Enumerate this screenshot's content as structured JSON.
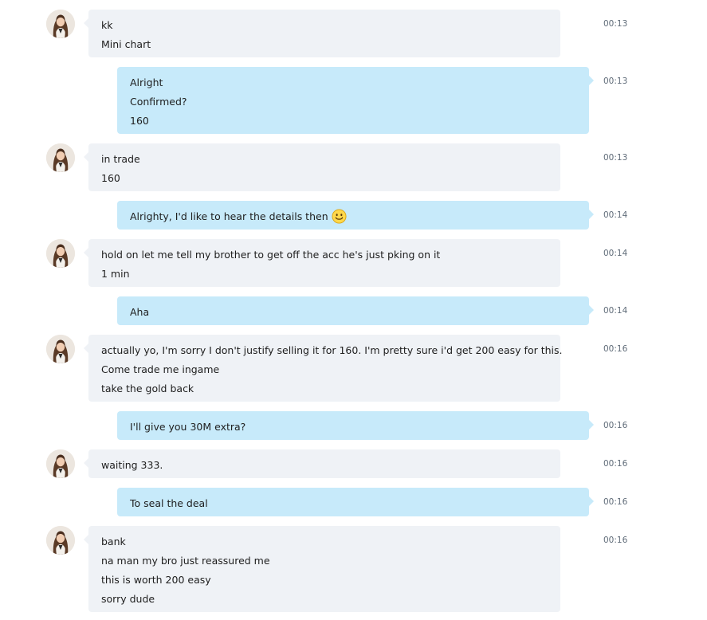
{
  "colors": {
    "incoming_bubble": "#eff2f6",
    "outgoing_bubble": "#c7eafa",
    "timestamp": "#5f6b78"
  },
  "messages": [
    {
      "direction": "incoming",
      "time": "00:13",
      "lines": [
        "kk",
        "Mini chart"
      ]
    },
    {
      "direction": "outgoing",
      "time": "00:13",
      "lines": [
        "Alright",
        "Confirmed?",
        "160"
      ]
    },
    {
      "direction": "incoming",
      "time": "00:13",
      "lines": [
        "in trade",
        "160"
      ]
    },
    {
      "direction": "outgoing",
      "time": "00:14",
      "lines": [
        "Alrighty, I'd like to hear the details then"
      ],
      "emoji": "smiley-emoji-icon"
    },
    {
      "direction": "incoming",
      "time": "00:14",
      "lines": [
        "hold on let me tell my brother to get off the acc he's just pking on it",
        "1 min"
      ]
    },
    {
      "direction": "outgoing",
      "time": "00:14",
      "lines": [
        "Aha"
      ]
    },
    {
      "direction": "incoming",
      "time": "00:16",
      "lines": [
        "actually yo, I'm sorry I don't justify selling it for 160. I'm pretty sure i'd get 200 easy for this.",
        "Come trade me ingame",
        "take the gold back"
      ]
    },
    {
      "direction": "outgoing",
      "time": "00:16",
      "lines": [
        "I'll give you 30M extra?"
      ]
    },
    {
      "direction": "incoming",
      "time": "00:16",
      "lines": [
        "waiting 333."
      ]
    },
    {
      "direction": "outgoing",
      "time": "00:16",
      "lines": [
        "To seal the deal"
      ]
    },
    {
      "direction": "incoming",
      "time": "00:16",
      "lines": [
        "bank",
        "na man my bro just reassured me",
        "this is worth 200 easy",
        "sorry dude"
      ]
    }
  ]
}
